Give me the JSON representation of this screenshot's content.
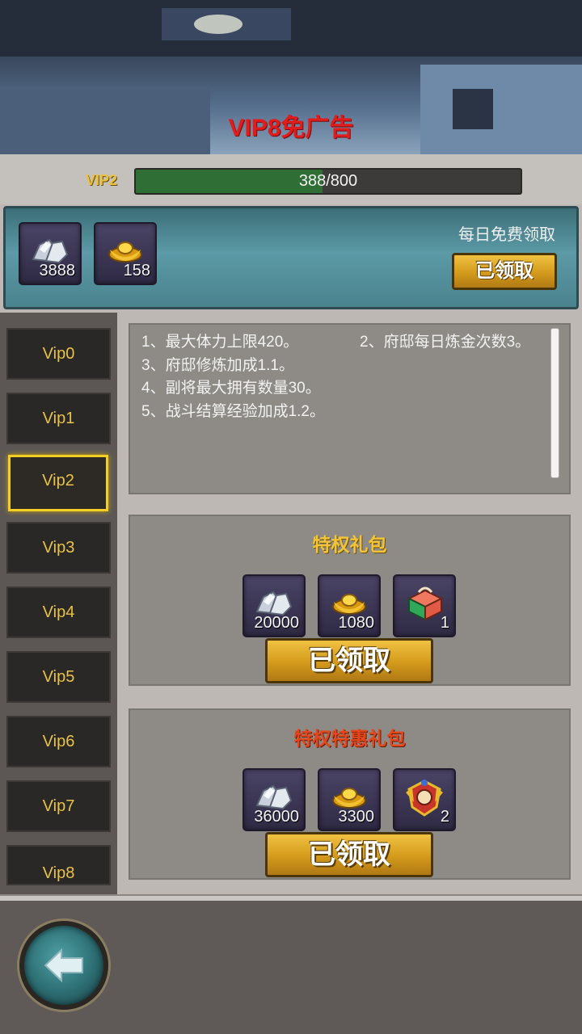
{
  "banner": {
    "title": "VIP8免广告"
  },
  "vip": {
    "level": "VIP2",
    "current": 388,
    "target": 800,
    "progress_text": "388/800",
    "progress_fraction": 0.485
  },
  "daily": {
    "label": "每日免费领取",
    "items": [
      {
        "icon": "silver-ore-icon",
        "qty": "3888"
      },
      {
        "icon": "gold-ingot-icon",
        "qty": "158"
      }
    ],
    "button_label": "已领取"
  },
  "sidebar": {
    "tabs": [
      "Vip0",
      "Vip1",
      "Vip2",
      "Vip3",
      "Vip4",
      "Vip5",
      "Vip6",
      "Vip7",
      "Vip8"
    ],
    "active": "Vip2"
  },
  "description": {
    "lines": [
      "1、最大体力上限420。",
      "2、府邸每日炼金次数3。",
      "3、府邸修炼加成1.1。",
      "4、副将最大拥有数量30。",
      "5、战斗结算经验加成1.2。"
    ]
  },
  "packs": [
    {
      "title": "特权礼包",
      "items": [
        {
          "icon": "silver-ore-icon",
          "qty": "20000"
        },
        {
          "icon": "gold-ingot-icon",
          "qty": "1080"
        },
        {
          "icon": "gift-box-icon",
          "qty": "1"
        }
      ],
      "button_label": "已领取"
    },
    {
      "title": "特权特惠礼包",
      "items": [
        {
          "icon": "silver-ore-icon",
          "qty": "36000"
        },
        {
          "icon": "gold-ingot-icon",
          "qty": "3300"
        },
        {
          "icon": "summon-emblem-icon",
          "qty": "2"
        }
      ],
      "button_label": "已领取"
    }
  ],
  "colors": {
    "accent_gold": "#f3c535",
    "accent_red": "#e5471d",
    "banner_red": "#e21b1b",
    "progress_green": "#2f6e34"
  }
}
